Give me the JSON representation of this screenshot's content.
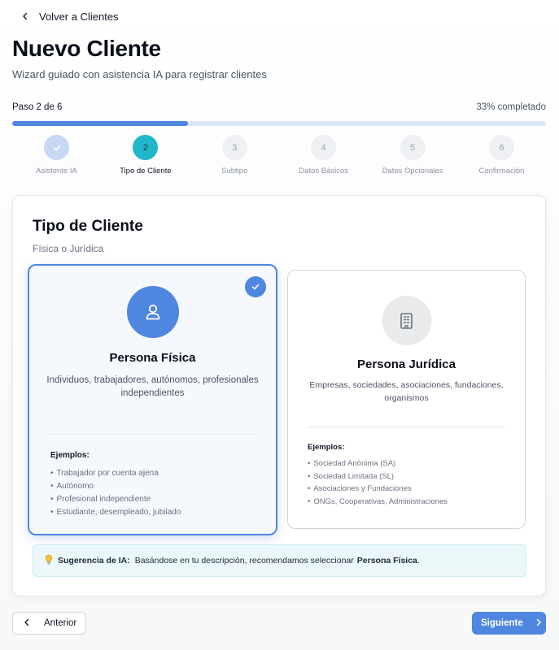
{
  "nav": {
    "back_label": "Volver a Clientes"
  },
  "header": {
    "title": "Nuevo Cliente",
    "subtitle": "Wizard guiado con asistencia IA para registrar clientes"
  },
  "progress": {
    "step_text": "Paso 2 de 6",
    "percent_text": "33% completado",
    "fraction": 0.33
  },
  "steps": [
    {
      "number": "1",
      "label": "Asistente IA",
      "status": "done"
    },
    {
      "number": "2",
      "label": "Tipo de Cliente",
      "status": "active"
    },
    {
      "number": "3",
      "label": "Subtipo",
      "status": "pending"
    },
    {
      "number": "4",
      "label": "Datos Básicos",
      "status": "pending"
    },
    {
      "number": "5",
      "label": "Datos Opcionales",
      "status": "pending"
    },
    {
      "number": "6",
      "label": "Confirmación",
      "status": "pending"
    }
  ],
  "card": {
    "title": "Tipo de Cliente",
    "subtitle": "Física o Jurídica",
    "options": [
      {
        "title": "Persona Física",
        "description": "Individuos, trabajadores, autónomos, profesionales independientes",
        "examples_label": "Ejemplos:",
        "examples": [
          "Trabajador por cuenta ajena",
          "Autónomo",
          "Profesional independiente",
          "Estudiante, desempleado, jubilado"
        ],
        "icon": "user-icon",
        "selected": true
      },
      {
        "title": "Persona Jurídica",
        "description": "Empresas, sociedades, asociaciones, fundaciones, organismos",
        "examples_label": "Ejemplos:",
        "examples": [
          "Sociedad Anónima (SA)",
          "Sociedad Limitada (SL)",
          "Asociaciones y Fundaciones",
          "ONGs, Cooperativas, Administraciones"
        ],
        "icon": "building-icon",
        "selected": false
      }
    ],
    "ai_tip": {
      "prefix": "Sugerencia de IA:",
      "text": "Basándose en tu descripción, recomendamos seleccionar",
      "highlight": "Persona Física",
      "suffix": "."
    }
  },
  "footer": {
    "prev_label": "Anterior",
    "next_label": "Siguiente"
  },
  "colors": {
    "accent": "#4f86e0",
    "active_step": "#21b6cb",
    "completed_step": "#c7d8f4",
    "tip_background": "#ecf7fa"
  }
}
